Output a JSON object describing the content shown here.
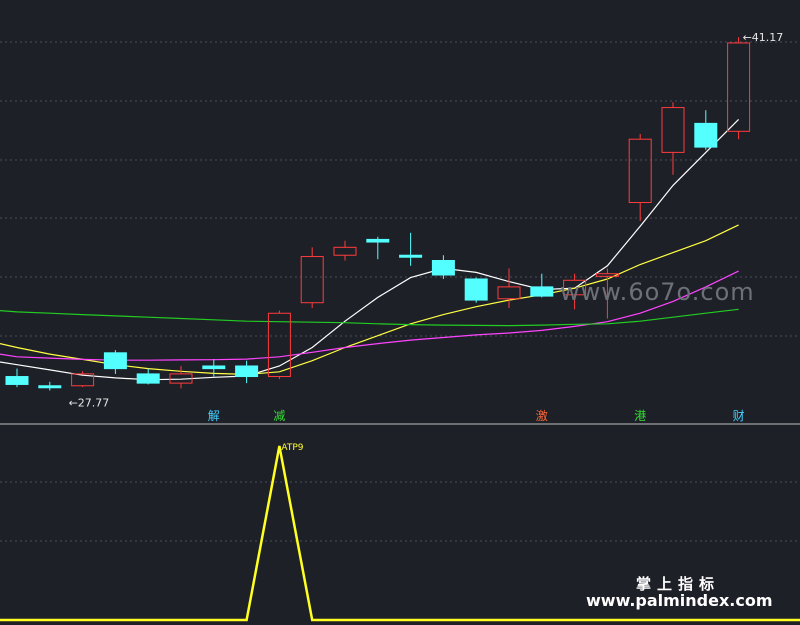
{
  "chart_data": {
    "type": "candlestick",
    "price_range": [
      26.5,
      42.2
    ],
    "max_label": "41.17",
    "min_label": "27.77",
    "candles": [
      {
        "o": 28.3,
        "h": 28.6,
        "l": 27.9,
        "c": 28.0,
        "dir": "down"
      },
      {
        "o": 27.95,
        "h": 28.1,
        "l": 27.77,
        "c": 27.9,
        "dir": "down"
      },
      {
        "o": 28.4,
        "h": 28.5,
        "l": 27.9,
        "c": 27.95,
        "dir": "up"
      },
      {
        "o": 29.2,
        "h": 29.3,
        "l": 28.4,
        "c": 28.6,
        "dir": "down"
      },
      {
        "o": 28.4,
        "h": 28.6,
        "l": 28.0,
        "c": 28.05,
        "dir": "down"
      },
      {
        "o": 28.05,
        "h": 28.7,
        "l": 27.85,
        "c": 28.4,
        "dir": "up"
      },
      {
        "o": 28.7,
        "h": 28.95,
        "l": 28.3,
        "c": 28.6,
        "dir": "down"
      },
      {
        "o": 28.7,
        "h": 28.9,
        "l": 28.05,
        "c": 28.3,
        "dir": "down"
      },
      {
        "o": 28.3,
        "h": 30.8,
        "l": 28.2,
        "c": 30.7,
        "dir": "up"
      },
      {
        "o": 31.1,
        "h": 33.2,
        "l": 30.9,
        "c": 32.85,
        "dir": "up"
      },
      {
        "o": 32.9,
        "h": 33.45,
        "l": 32.7,
        "c": 33.2,
        "dir": "up"
      },
      {
        "o": 33.5,
        "h": 33.6,
        "l": 32.75,
        "c": 33.4,
        "dir": "down"
      },
      {
        "o": 32.9,
        "h": 33.75,
        "l": 32.5,
        "c": 32.85,
        "dir": "down"
      },
      {
        "o": 32.7,
        "h": 32.9,
        "l": 32.0,
        "c": 32.15,
        "dir": "down"
      },
      {
        "o": 32.0,
        "h": 32.05,
        "l": 31.1,
        "c": 31.2,
        "dir": "down"
      },
      {
        "o": 31.25,
        "h": 32.4,
        "l": 30.9,
        "c": 31.7,
        "dir": "up"
      },
      {
        "o": 31.7,
        "h": 32.2,
        "l": 31.3,
        "c": 31.35,
        "dir": "down"
      },
      {
        "o": 31.4,
        "h": 32.2,
        "l": 30.85,
        "c": 31.95,
        "dir": "up"
      },
      {
        "o": 32.2,
        "h": 32.4,
        "l": 30.5,
        "c": 32.1,
        "dir": "up"
      },
      {
        "o": 34.9,
        "h": 37.5,
        "l": 34.2,
        "c": 37.3,
        "dir": "up"
      },
      {
        "o": 36.8,
        "h": 38.7,
        "l": 35.95,
        "c": 38.5,
        "dir": "up"
      },
      {
        "o": 37.9,
        "h": 38.4,
        "l": 36.9,
        "c": 37.0,
        "dir": "down"
      },
      {
        "o": 37.6,
        "h": 41.17,
        "l": 37.3,
        "c": 40.95,
        "dir": "up"
      }
    ],
    "ma_lines": [
      {
        "color": "#ffffff",
        "values": [
          28.75,
          28.55,
          28.35,
          28.25,
          28.18,
          28.2,
          28.27,
          28.32,
          28.7,
          29.4,
          30.4,
          31.3,
          32.05,
          32.4,
          32.25,
          31.9,
          31.6,
          31.65,
          32.5,
          34.0,
          35.55,
          36.8,
          38.05
        ]
      },
      {
        "color": "#ffff44",
        "values": [
          29.4,
          29.15,
          28.95,
          28.75,
          28.6,
          28.5,
          28.42,
          28.38,
          28.48,
          28.9,
          29.4,
          29.85,
          30.3,
          30.65,
          30.95,
          31.2,
          31.4,
          31.65,
          32.0,
          32.55,
          33.0,
          33.45,
          34.05
        ]
      },
      {
        "color": "#ff44ff",
        "values": [
          29.05,
          29.0,
          28.95,
          28.92,
          28.92,
          28.93,
          28.94,
          28.96,
          29.05,
          29.22,
          29.4,
          29.55,
          29.68,
          29.78,
          29.88,
          29.95,
          30.05,
          30.2,
          30.38,
          30.7,
          31.15,
          31.7,
          32.3
        ]
      },
      {
        "color": "#22cc22",
        "values": [
          30.75,
          30.7,
          30.65,
          30.6,
          30.55,
          30.5,
          30.45,
          30.4,
          30.38,
          30.36,
          30.34,
          30.3,
          30.27,
          30.25,
          30.24,
          30.23,
          30.25,
          30.28,
          30.3,
          30.4,
          30.55,
          30.7,
          30.85
        ]
      }
    ],
    "ma_extrapolate_left": {
      "white": {
        "x": 0,
        "v": 28.85
      },
      "yellow": {
        "x": 0,
        "v": 29.55
      },
      "magenta": {
        "x": 0,
        "v": 29.15
      },
      "green": {
        "x": 0,
        "v": 30.8
      }
    },
    "signal_tags": [
      {
        "index": 6,
        "text": "解",
        "color": "#44d0ff"
      },
      {
        "index": 8,
        "text": "减",
        "color": "#33dd33"
      },
      {
        "index": 16,
        "text": "激",
        "color": "#ff6633"
      },
      {
        "index": 19,
        "text": "港",
        "color": "#33dd33"
      },
      {
        "index": 22,
        "text": "财",
        "color": "#44d0ff"
      }
    ],
    "oscillator": {
      "color": "#ffff22",
      "label": "ATP9",
      "series": [
        0,
        0,
        0,
        0,
        0,
        0,
        0,
        0,
        1,
        0,
        0,
        0,
        0,
        0,
        0,
        0,
        0,
        0,
        0,
        0,
        0,
        0,
        0
      ]
    }
  },
  "watermark": "www.6o7o.com",
  "brand": {
    "name": "掌上指标",
    "url": "www.palmindex.com"
  }
}
